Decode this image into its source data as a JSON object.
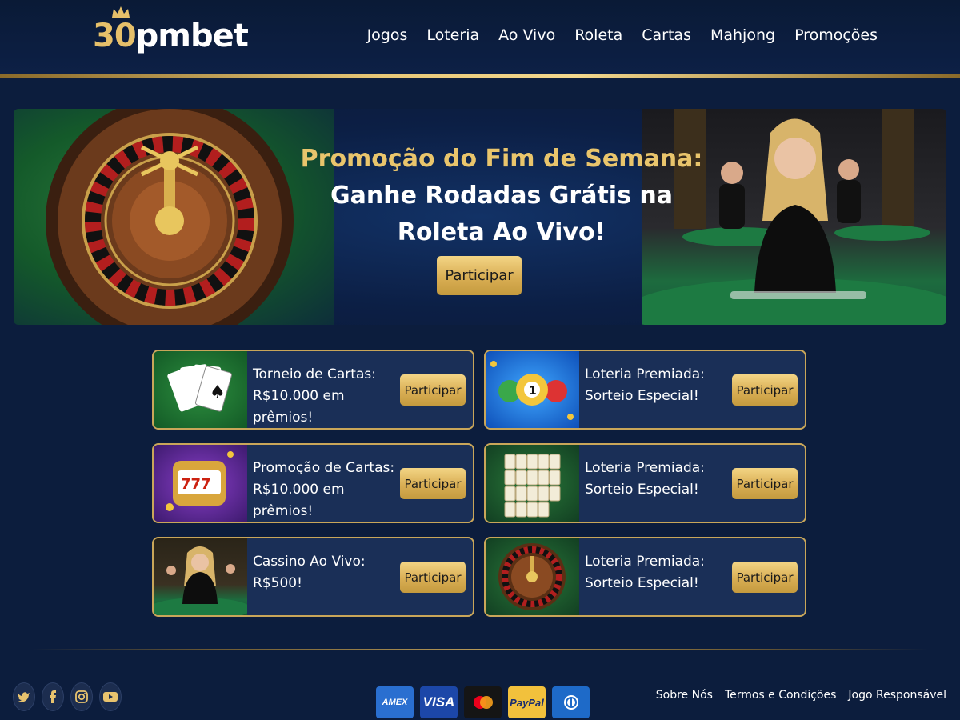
{
  "header": {
    "logo_num": "30",
    "logo_rest": "pmbet",
    "nav": [
      "Jogos",
      "Loteria",
      "Ao Vivo",
      "Roleta",
      "Cartas",
      "Mahjong",
      "Promoções"
    ]
  },
  "banner": {
    "title_gold": "Promoção do Fim de Semana:",
    "title_line2": "Ganhe Rodadas Grátis na",
    "title_line3": "Roleta Ao Vivo!",
    "button": "Participar"
  },
  "cards": [
    {
      "line1": "Torneio de Cartas:",
      "line2": "R$10.000 em prêmios!",
      "button": "Participar",
      "thumb": "playing-cards-icon"
    },
    {
      "line1": "Loteria Premiada:",
      "line2": "Sorteio Especial!",
      "button": "Participar",
      "thumb": "lottery-balls-icon"
    },
    {
      "line1": "Promoção de Cartas:",
      "line2": "R$10.000 em prêmios!",
      "button": "Participar",
      "thumb": "slot-machine-icon"
    },
    {
      "line1": "Loteria Premiada:",
      "line2": "Sorteio Especial!",
      "button": "Participar",
      "thumb": "mahjong-tiles-icon"
    },
    {
      "line1": "Cassino Ao Vivo:",
      "line2": "R$500!",
      "button": "Participar",
      "thumb": "live-casino-image"
    },
    {
      "line1": "Loteria Premiada:",
      "line2": "Sorteio Especial!",
      "button": "Participar",
      "thumb": "roulette-icon"
    }
  ],
  "footer": {
    "social": [
      "twitter-icon",
      "facebook-icon",
      "instagram-icon",
      "youtube-icon"
    ],
    "payments": {
      "amex": "AMEX",
      "visa": "VISA",
      "paypal": "PayPal"
    },
    "links": [
      "Sobre Nós",
      "Termos e Condições",
      "Jogo Responsável"
    ]
  },
  "colors": {
    "gold": "#e9c56c",
    "background": "#0c1d3d",
    "card": "#1a2f57"
  }
}
